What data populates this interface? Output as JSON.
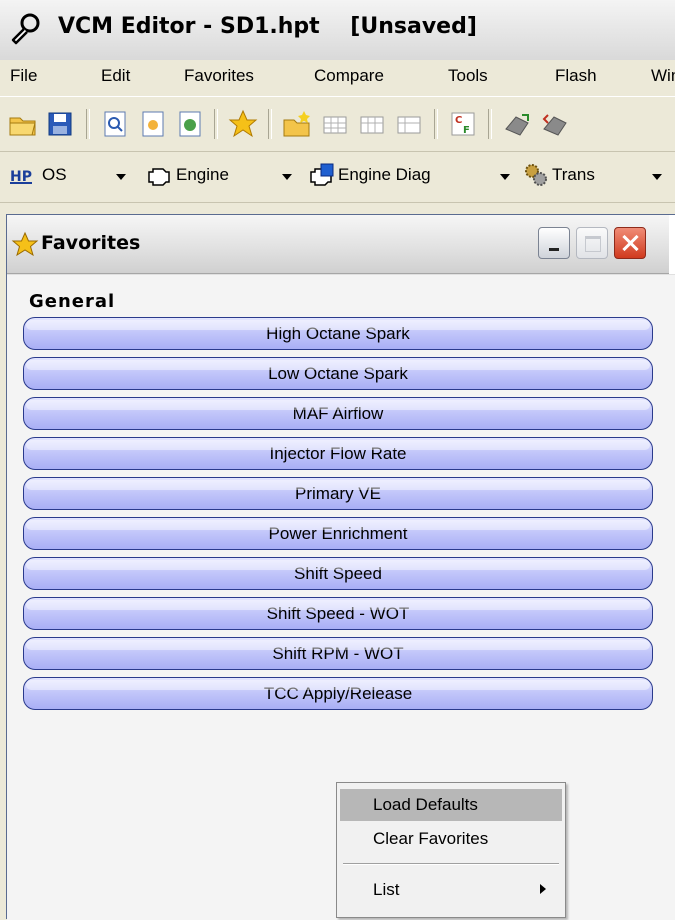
{
  "window": {
    "title": "VCM Editor - SD1.hpt    [Unsaved]"
  },
  "menu": [
    "File",
    "Edit",
    "Favorites",
    "Compare",
    "Tools",
    "Flash",
    "Win"
  ],
  "toolbar_icons": [
    "open-folder-icon",
    "save-icon",
    "find-icon",
    "open-file-icon",
    "compare-file-icon",
    "favorites-star-icon",
    "new-folder-icon",
    "table-icon",
    "table-compare-icon",
    "table-diff-icon",
    "checksum-icon",
    "read-vehicle-icon",
    "write-vehicle-icon"
  ],
  "tabs": [
    {
      "label": "OS",
      "icon": "hp-logo-icon"
    },
    {
      "label": "Engine",
      "icon": "engine-icon"
    },
    {
      "label": "Engine Diag",
      "icon": "engine-diag-icon"
    },
    {
      "label": "Trans",
      "icon": "trans-gear-icon"
    }
  ],
  "favorites_window": {
    "title": "Favorites",
    "group": "General",
    "items": [
      "High Octane Spark",
      "Low Octane Spark",
      "MAF Airflow",
      "Injector Flow Rate",
      "Primary VE",
      "Power Enrichment",
      "Shift Speed",
      "Shift Speed - WOT",
      "Shift RPM - WOT",
      "TCC Apply/Release"
    ]
  },
  "context_menu": {
    "items": [
      "Load Defaults",
      "Clear Favorites",
      "List"
    ],
    "highlighted": "Load Defaults"
  },
  "colors": {
    "button_fill": "#c3c7fa",
    "button_border": "#2a3a8c",
    "close_red": "#d03a1e",
    "menu_highlight": "#b7b7b7"
  }
}
